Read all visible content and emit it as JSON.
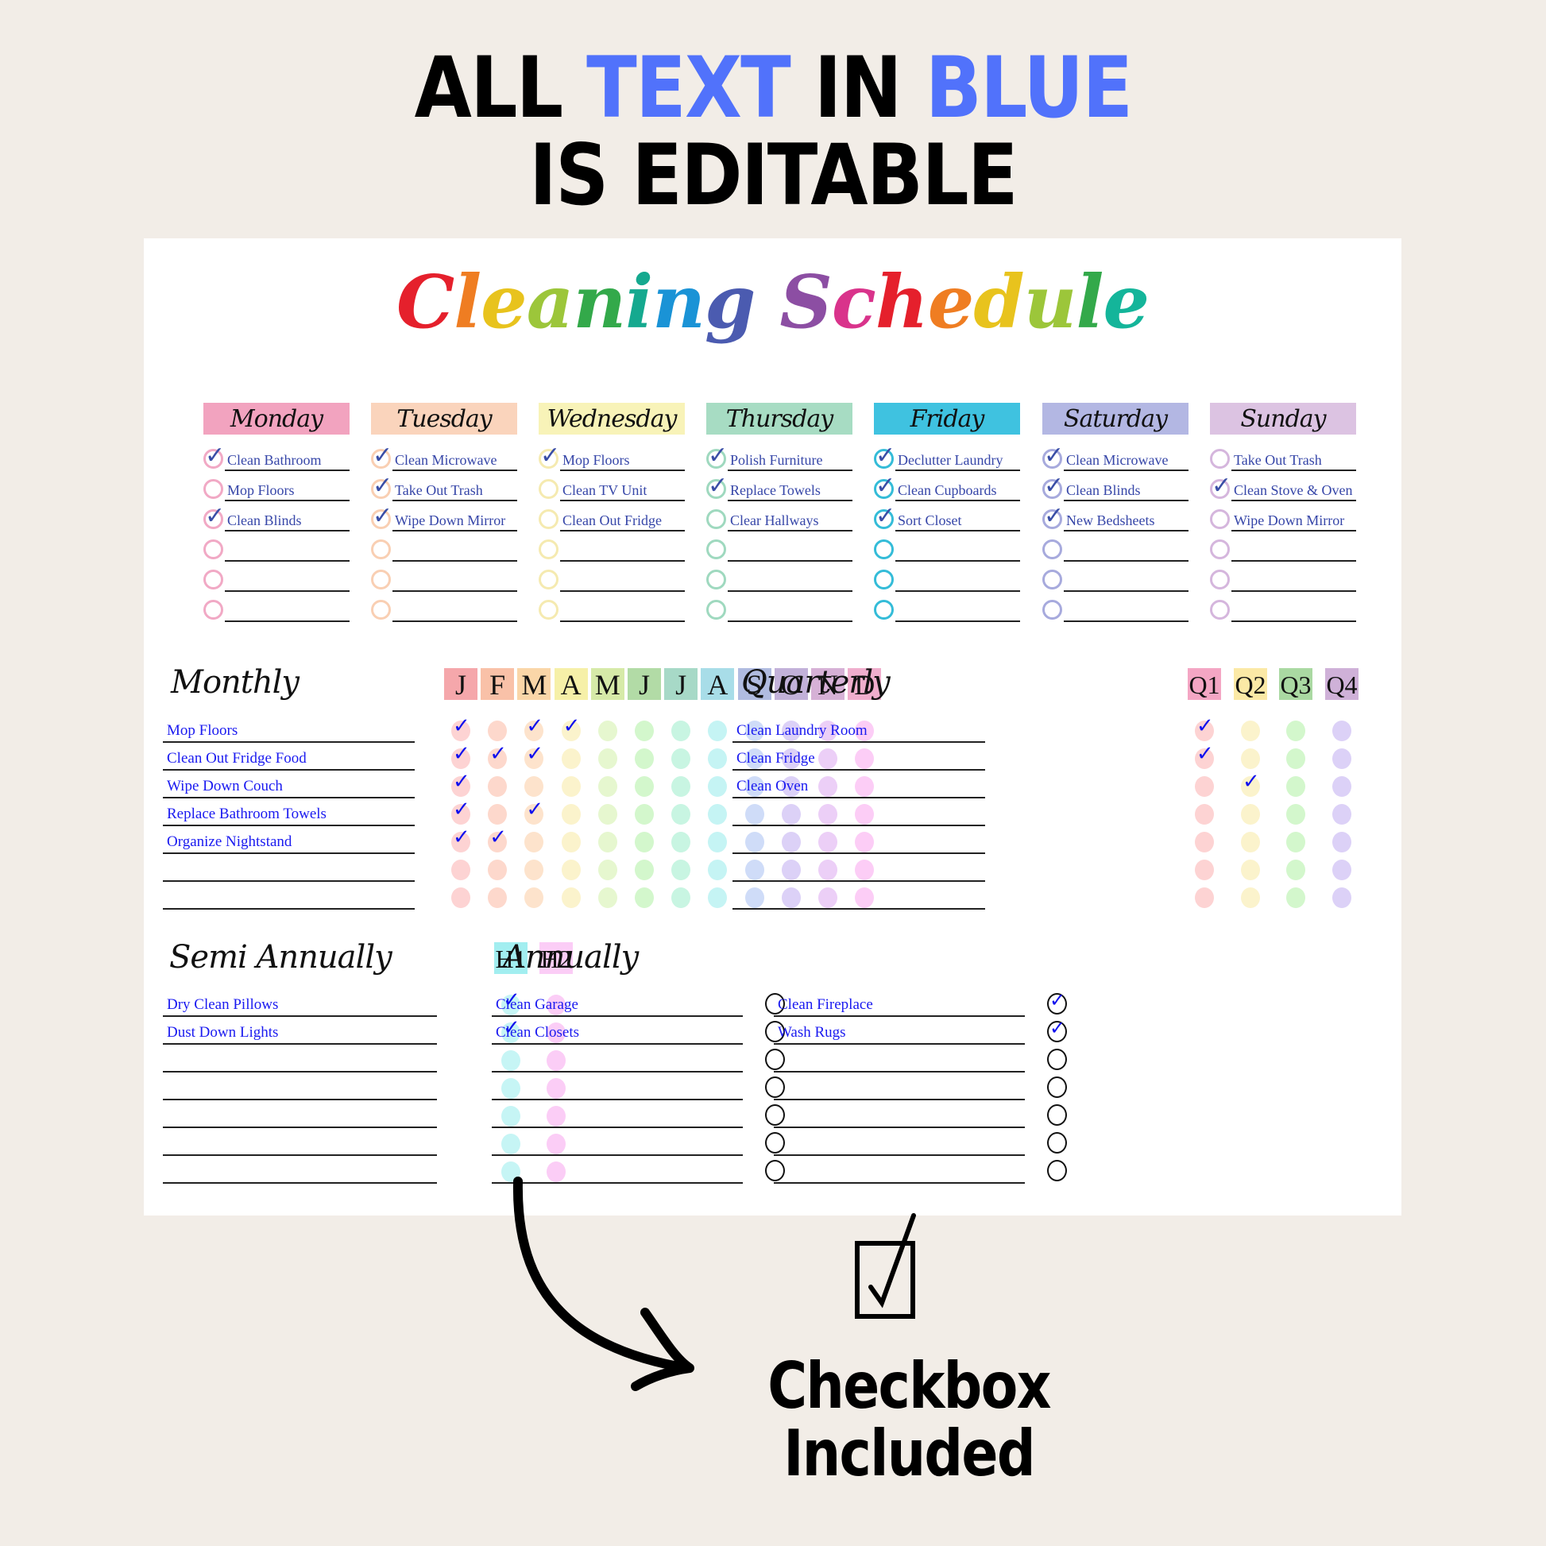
{
  "banner": {
    "line1": [
      {
        "text": "All ",
        "blue": false
      },
      {
        "text": "TEXT ",
        "blue": true
      },
      {
        "text": "IN ",
        "blue": false
      },
      {
        "text": "BLUE",
        "blue": true
      }
    ],
    "line2": "IS EDITABLE",
    "blue_color": "#5172fb"
  },
  "sheet": {
    "title": "Cleaning Schedule",
    "title_colors": [
      "#e5202c",
      "#ef7d22",
      "#e8c31d",
      "#9cc63a",
      "#33a94a",
      "#15a98f",
      "#1a93d6",
      "#4b5bb0",
      "#8c4ea3",
      "#d9338b",
      "#e5202c",
      "#ef7d22",
      "#e8c31d",
      "#9cc63a",
      "#33a94a",
      "#14b59a",
      "#15a98f"
    ],
    "weekly": [
      {
        "day": "Monday",
        "color": "#f2a3bf",
        "ring": "#f1a9c5",
        "tasks": [
          {
            "text": "Clean Bathroom",
            "done": true
          },
          {
            "text": "Mop Floors",
            "done": false
          },
          {
            "text": "Clean Blinds",
            "done": true
          },
          {
            "text": "",
            "done": false
          },
          {
            "text": "",
            "done": false
          },
          {
            "text": "",
            "done": false
          }
        ]
      },
      {
        "day": "Tuesday",
        "color": "#fad4bc",
        "ring": "#f9cfb3",
        "tasks": [
          {
            "text": "Clean Microwave",
            "done": true
          },
          {
            "text": "Take Out Trash",
            "done": true
          },
          {
            "text": "Wipe Down Mirror",
            "done": true
          },
          {
            "text": "",
            "done": false
          },
          {
            "text": "",
            "done": false
          },
          {
            "text": "",
            "done": false
          }
        ]
      },
      {
        "day": "Wednesday",
        "color": "#f8f3b8",
        "ring": "#f5eab0",
        "tasks": [
          {
            "text": "Mop Floors",
            "done": true
          },
          {
            "text": "Clean TV Unit",
            "done": false
          },
          {
            "text": "Clean Out Fridge",
            "done": false
          },
          {
            "text": "",
            "done": false
          },
          {
            "text": "",
            "done": false
          },
          {
            "text": "",
            "done": false
          }
        ]
      },
      {
        "day": "Thursday",
        "color": "#a7dcc3",
        "ring": "#9fd9bf",
        "tasks": [
          {
            "text": "Polish Furniture",
            "done": true
          },
          {
            "text": "Replace Towels",
            "done": true
          },
          {
            "text": "Clear Hallways",
            "done": false
          },
          {
            "text": "",
            "done": false
          },
          {
            "text": "",
            "done": false
          },
          {
            "text": "",
            "done": false
          }
        ]
      },
      {
        "day": "Friday",
        "color": "#3fc2e0",
        "ring": "#34bcd8",
        "tasks": [
          {
            "text": "Declutter Laundry",
            "done": true
          },
          {
            "text": "Clean Cupboards",
            "done": true
          },
          {
            "text": "Sort Closet",
            "done": true
          },
          {
            "text": "",
            "done": false
          },
          {
            "text": "",
            "done": false
          },
          {
            "text": "",
            "done": false
          }
        ]
      },
      {
        "day": "Saturday",
        "color": "#b3b7e3",
        "ring": "#a7aadd",
        "tasks": [
          {
            "text": "Clean Microwave",
            "done": true
          },
          {
            "text": "Clean Blinds",
            "done": true
          },
          {
            "text": "New Bedsheets",
            "done": true
          },
          {
            "text": "",
            "done": false
          },
          {
            "text": "",
            "done": false
          },
          {
            "text": "",
            "done": false
          }
        ]
      },
      {
        "day": "Sunday",
        "color": "#dcc3e2",
        "ring": "#d5b6dd",
        "tasks": [
          {
            "text": "Take Out Trash",
            "done": false
          },
          {
            "text": "Clean Stove & Oven",
            "done": true
          },
          {
            "text": "Wipe Down Mirror",
            "done": false
          },
          {
            "text": "",
            "done": false
          },
          {
            "text": "",
            "done": false
          },
          {
            "text": "",
            "done": false
          }
        ]
      }
    ],
    "monthly": {
      "title": "Monthly",
      "months": [
        {
          "label": "J",
          "head": "#f5a7ab",
          "dot": "#fdd3d3"
        },
        {
          "label": "F",
          "head": "#f9c1a8",
          "dot": "#fdd8cc"
        },
        {
          "label": "M",
          "head": "#fad6a8",
          "dot": "#fde3cc"
        },
        {
          "label": "A",
          "head": "#f6f0a8",
          "dot": "#fbf3cc"
        },
        {
          "label": "M",
          "head": "#d6eaa8",
          "dot": "#e6f7cf"
        },
        {
          "label": "J",
          "head": "#b2dba6",
          "dot": "#d3f7cc"
        },
        {
          "label": "J",
          "head": "#a7d9c7",
          "dot": "#c8f5e2"
        },
        {
          "label": "A",
          "head": "#a8dde8",
          "dot": "#c5f4f4"
        },
        {
          "label": "S",
          "head": "#b0bbe0",
          "dot": "#cfdcf8"
        },
        {
          "label": "O",
          "head": "#c2b1d9",
          "dot": "#dcd1f7"
        },
        {
          "label": "N",
          "head": "#d6b1d6",
          "dot": "#eccff7"
        },
        {
          "label": "D",
          "head": "#f0aecd",
          "dot": "#fccdf6"
        }
      ],
      "tasks": [
        {
          "text": "Mop Floors",
          "done": [
            1,
            0,
            1,
            1,
            0,
            0,
            0,
            0,
            0,
            0,
            0,
            0
          ]
        },
        {
          "text": "Clean Out Fridge Food",
          "done": [
            1,
            1,
            1,
            0,
            0,
            0,
            0,
            0,
            0,
            0,
            0,
            0
          ]
        },
        {
          "text": "Wipe Down Couch",
          "done": [
            1,
            0,
            0,
            0,
            0,
            0,
            0,
            0,
            0,
            0,
            0,
            0
          ]
        },
        {
          "text": "Replace Bathroom Towels",
          "done": [
            1,
            0,
            1,
            0,
            0,
            0,
            0,
            0,
            0,
            0,
            0,
            0
          ]
        },
        {
          "text": "Organize Nightstand",
          "done": [
            1,
            1,
            0,
            0,
            0,
            0,
            0,
            0,
            0,
            0,
            0,
            0
          ]
        },
        {
          "text": "",
          "done": [
            0,
            0,
            0,
            0,
            0,
            0,
            0,
            0,
            0,
            0,
            0,
            0
          ]
        },
        {
          "text": "",
          "done": [
            0,
            0,
            0,
            0,
            0,
            0,
            0,
            0,
            0,
            0,
            0,
            0
          ]
        }
      ]
    },
    "quarterly": {
      "title": "Quarterly",
      "quarters": [
        {
          "label": "Q1",
          "head": "#f4a6c4",
          "dot": "#fdd3d3"
        },
        {
          "label": "Q2",
          "head": "#fbe9a6",
          "dot": "#fbf3cc"
        },
        {
          "label": "Q3",
          "head": "#aad9a2",
          "dot": "#d3f7cc"
        },
        {
          "label": "Q4",
          "head": "#cfb1d8",
          "dot": "#dcd1f7"
        }
      ],
      "tasks": [
        {
          "text": "Clean Laundry Room",
          "done": [
            1,
            0,
            0,
            0
          ]
        },
        {
          "text": "Clean Fridge",
          "done": [
            1,
            0,
            0,
            0
          ]
        },
        {
          "text": "Clean Oven",
          "done": [
            0,
            1,
            0,
            0
          ]
        },
        {
          "text": "",
          "done": [
            0,
            0,
            0,
            0
          ]
        },
        {
          "text": "",
          "done": [
            0,
            0,
            0,
            0
          ]
        },
        {
          "text": "",
          "done": [
            0,
            0,
            0,
            0
          ]
        },
        {
          "text": "",
          "done": [
            0,
            0,
            0,
            0
          ]
        }
      ]
    },
    "semi_annually": {
      "title": "Semi Annually",
      "halves": [
        {
          "label": "H1",
          "head": "#a2eef0",
          "dot": "#c6f5f5"
        },
        {
          "label": "H2",
          "head": "#fbcdf6",
          "dot": "#fbcdf6"
        }
      ],
      "tasks": [
        {
          "text": "Dry Clean Pillows",
          "done": [
            1,
            0
          ]
        },
        {
          "text": "Dust Down Lights",
          "done": [
            1,
            0
          ]
        },
        {
          "text": "",
          "done": [
            0,
            0
          ]
        },
        {
          "text": "",
          "done": [
            0,
            0
          ]
        },
        {
          "text": "",
          "done": [
            0,
            0
          ]
        },
        {
          "text": "",
          "done": [
            0,
            0
          ]
        },
        {
          "text": "",
          "done": [
            0,
            0
          ]
        }
      ]
    },
    "annually": {
      "title": "Annually",
      "left": [
        {
          "text": "Clean Garage",
          "done": false
        },
        {
          "text": "Clean Closets",
          "done": false
        },
        {
          "text": "",
          "done": false
        },
        {
          "text": "",
          "done": false
        },
        {
          "text": "",
          "done": false
        },
        {
          "text": "",
          "done": false
        },
        {
          "text": "",
          "done": false
        }
      ],
      "right": [
        {
          "text": "Clean Fireplace",
          "done": true
        },
        {
          "text": "Wash Rugs",
          "done": true
        },
        {
          "text": "",
          "done": false
        },
        {
          "text": "",
          "done": false
        },
        {
          "text": "",
          "done": false
        },
        {
          "text": "",
          "done": false
        },
        {
          "text": "",
          "done": false
        }
      ]
    }
  },
  "promo": {
    "line1": "Checkbox",
    "line2": "Included"
  },
  "icons": {
    "check": "✓"
  }
}
